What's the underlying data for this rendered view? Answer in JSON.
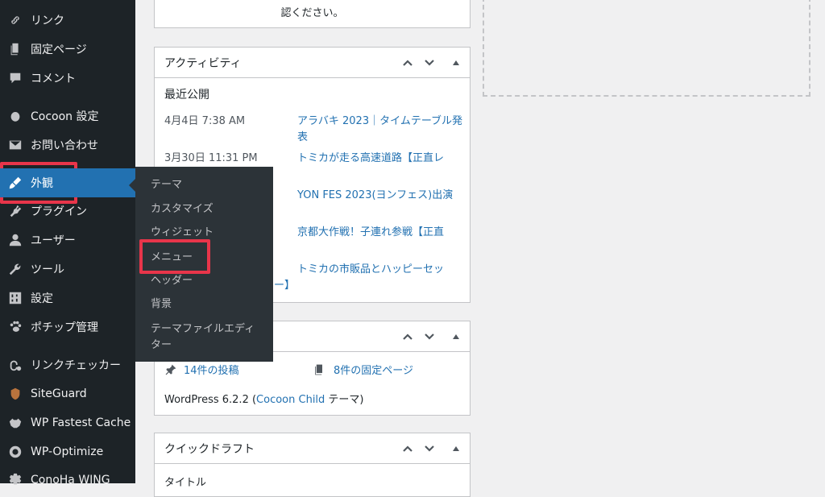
{
  "sidebar": {
    "items": [
      {
        "label": "リンク",
        "icon": "link-icon"
      },
      {
        "label": "固定ページ",
        "icon": "page-icon"
      },
      {
        "label": "コメント",
        "icon": "comment-icon"
      },
      {
        "label": "Cocoon 設定",
        "icon": "circle-icon"
      },
      {
        "label": "お問い合わせ",
        "icon": "mail-icon"
      },
      {
        "label": "外観",
        "icon": "paintbrush-icon",
        "current": true
      },
      {
        "label": "プラグイン",
        "icon": "plugin-icon"
      },
      {
        "label": "ユーザー",
        "icon": "user-icon"
      },
      {
        "label": "ツール",
        "icon": "wrench-icon"
      },
      {
        "label": "設定",
        "icon": "settings-icon"
      },
      {
        "label": "ポチップ管理",
        "icon": "paw-icon"
      },
      {
        "label": "リンクチェッカー",
        "icon": "link-checker-icon"
      },
      {
        "label": "SiteGuard",
        "icon": "siteguard-icon"
      },
      {
        "label": "WP Fastest Cache",
        "icon": "cheetah-icon"
      },
      {
        "label": "WP-Optimize",
        "icon": "optimize-icon"
      },
      {
        "label": "ConoHa WING",
        "icon": "gear-icon"
      }
    ]
  },
  "flyout": {
    "items": [
      "テーマ",
      "カスタマイズ",
      "ウィジェット",
      "メニュー",
      "ヘッダー",
      "背景",
      "テーマファイルエディター"
    ]
  },
  "top_panel": {
    "text": "認ください。"
  },
  "activity": {
    "title": "アクティビティ",
    "section": "最近公開",
    "rows": [
      {
        "date": "4月4日 7:38 AM",
        "title": "アラバキ 2023｜タイムテーブル発表"
      },
      {
        "date": "3月30日 11:31 PM",
        "title": "トミカが走る高速道路【正直レ"
      },
      {
        "date": "",
        "title": "YON FES 2023(ヨンフェス)出演"
      },
      {
        "date": "",
        "title": "京都大作戦！子連れ参戦【正直"
      },
      {
        "date": "",
        "title": "トミカの市販品とハッピーセッ"
      }
    ],
    "overflow_tail": "ー】"
  },
  "glance": {
    "posts": "14件の投稿",
    "pages": "8件の固定ページ",
    "wp_prefix": "WordPress 6.2.2 (",
    "theme_link": "Cocoon Child",
    "wp_suffix": " テーマ)"
  },
  "quickdraft": {
    "title": "クイックドラフト",
    "field_label": "タイトル"
  },
  "colors": {
    "accent": "#2271b1",
    "highlight": "#e8354a",
    "sidebar": "#1d2327"
  }
}
